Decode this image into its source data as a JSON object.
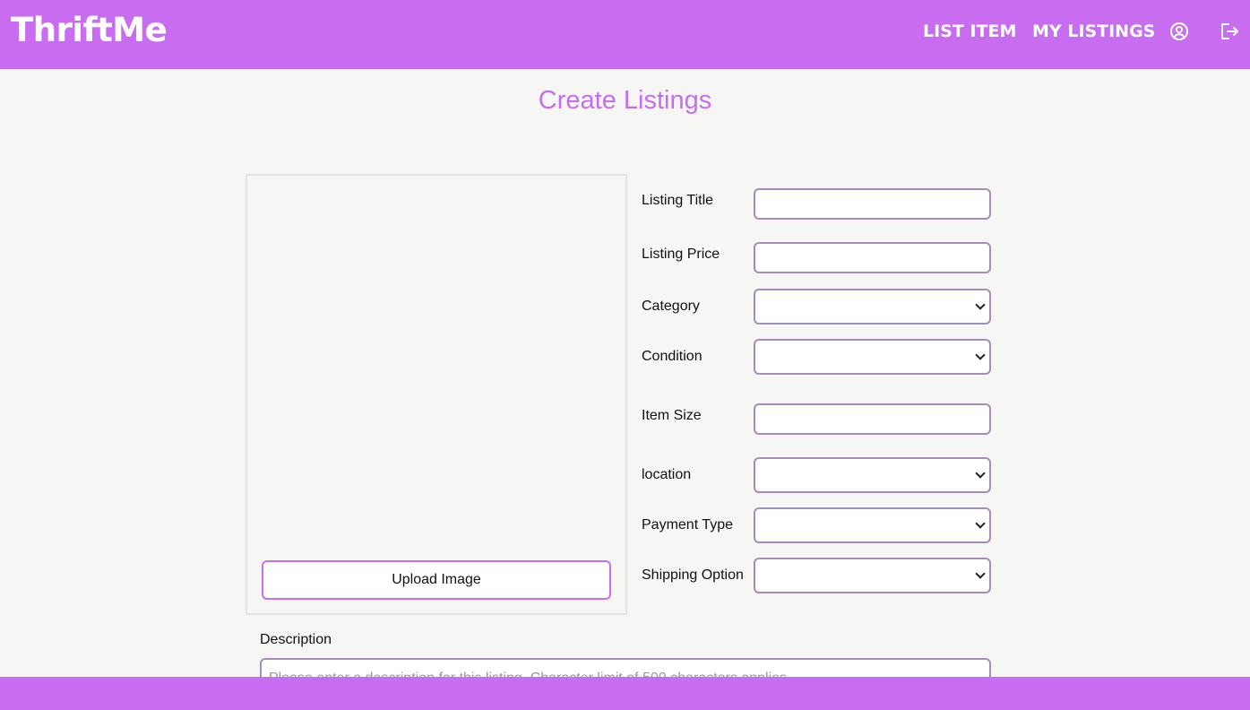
{
  "header": {
    "logo": "ThriftMe",
    "nav": {
      "list_item": "LIST ITEM",
      "my_listings": "MY LISTINGS"
    },
    "icons": {
      "profile": "user-circle-icon",
      "logout": "logout-icon"
    }
  },
  "page": {
    "title": "Create Listings"
  },
  "image_panel": {
    "upload_label": "Upload Image"
  },
  "form": {
    "fields": [
      {
        "label": "Listing Title",
        "type": "text",
        "value": ""
      },
      {
        "label": "Listing Price",
        "type": "text",
        "value": ""
      },
      {
        "label": "Category",
        "type": "select",
        "value": ""
      },
      {
        "label": "Condition",
        "type": "select",
        "value": ""
      },
      {
        "label": "Item Size",
        "type": "text",
        "value": ""
      },
      {
        "label": "location",
        "type": "select",
        "value": ""
      },
      {
        "label": "Payment Type",
        "type": "select",
        "value": ""
      },
      {
        "label": "Shipping Option",
        "type": "select",
        "value": ""
      }
    ],
    "description": {
      "label": "Description",
      "placeholder": "Please enter a description for this listing. Character limit of 500 characters applies."
    }
  },
  "colors": {
    "brand": "#c86df0",
    "background": "#f6f6f4",
    "field_border": "#a98bb8"
  }
}
